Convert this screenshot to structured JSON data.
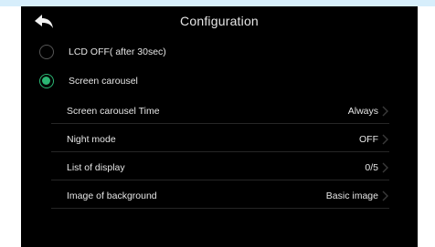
{
  "header": {
    "title": "Configuration",
    "back_icon": "back-arrow-icon"
  },
  "display_mode": [
    {
      "label": "LCD OFF( after 30sec)",
      "selected": false
    },
    {
      "label": "Screen carousel",
      "selected": true
    }
  ],
  "settings": [
    {
      "label": "Screen carousel Time",
      "value": "Always"
    },
    {
      "label": "Night mode",
      "value": "OFF"
    },
    {
      "label": "List of display",
      "value": "0/5"
    },
    {
      "label": "Image of background",
      "value": "Basic image"
    }
  ],
  "colors": {
    "accent": "#2bb673",
    "background": "#000000",
    "text": "#e6e6e6",
    "divider": "#262626",
    "top_strip": "#d7eefb"
  }
}
